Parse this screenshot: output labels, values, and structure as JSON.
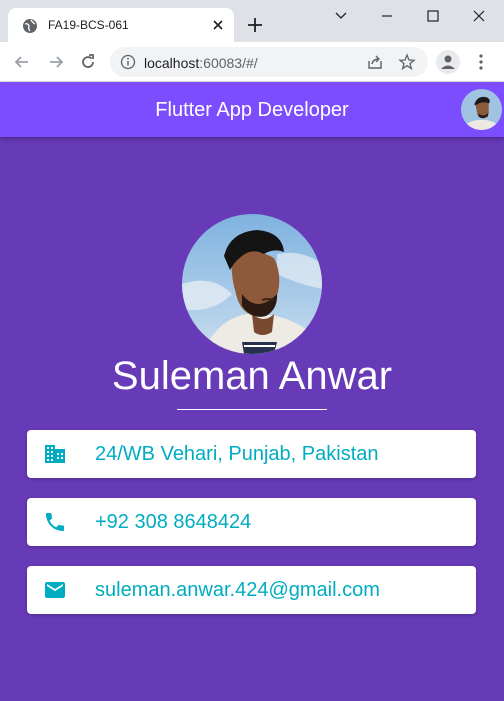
{
  "browser": {
    "tab_title": "FA19-BCS-061",
    "url_host": "localhost",
    "url_rest": ":60083/#/"
  },
  "appbar": {
    "title": "Flutter App Developer"
  },
  "profile": {
    "name": "Suleman Anwar"
  },
  "cards": [
    {
      "icon": "business-icon",
      "text": "24/WB Vehari, Punjab, Pakistan"
    },
    {
      "icon": "phone-icon",
      "text": "+92 308 8648424"
    },
    {
      "icon": "email-icon",
      "text": "suleman.anwar.424@gmail.com"
    }
  ],
  "colors": {
    "background": "#673ab7",
    "appbar": "#7c4dff",
    "accent": "#00acc1",
    "card": "#ffffff"
  }
}
